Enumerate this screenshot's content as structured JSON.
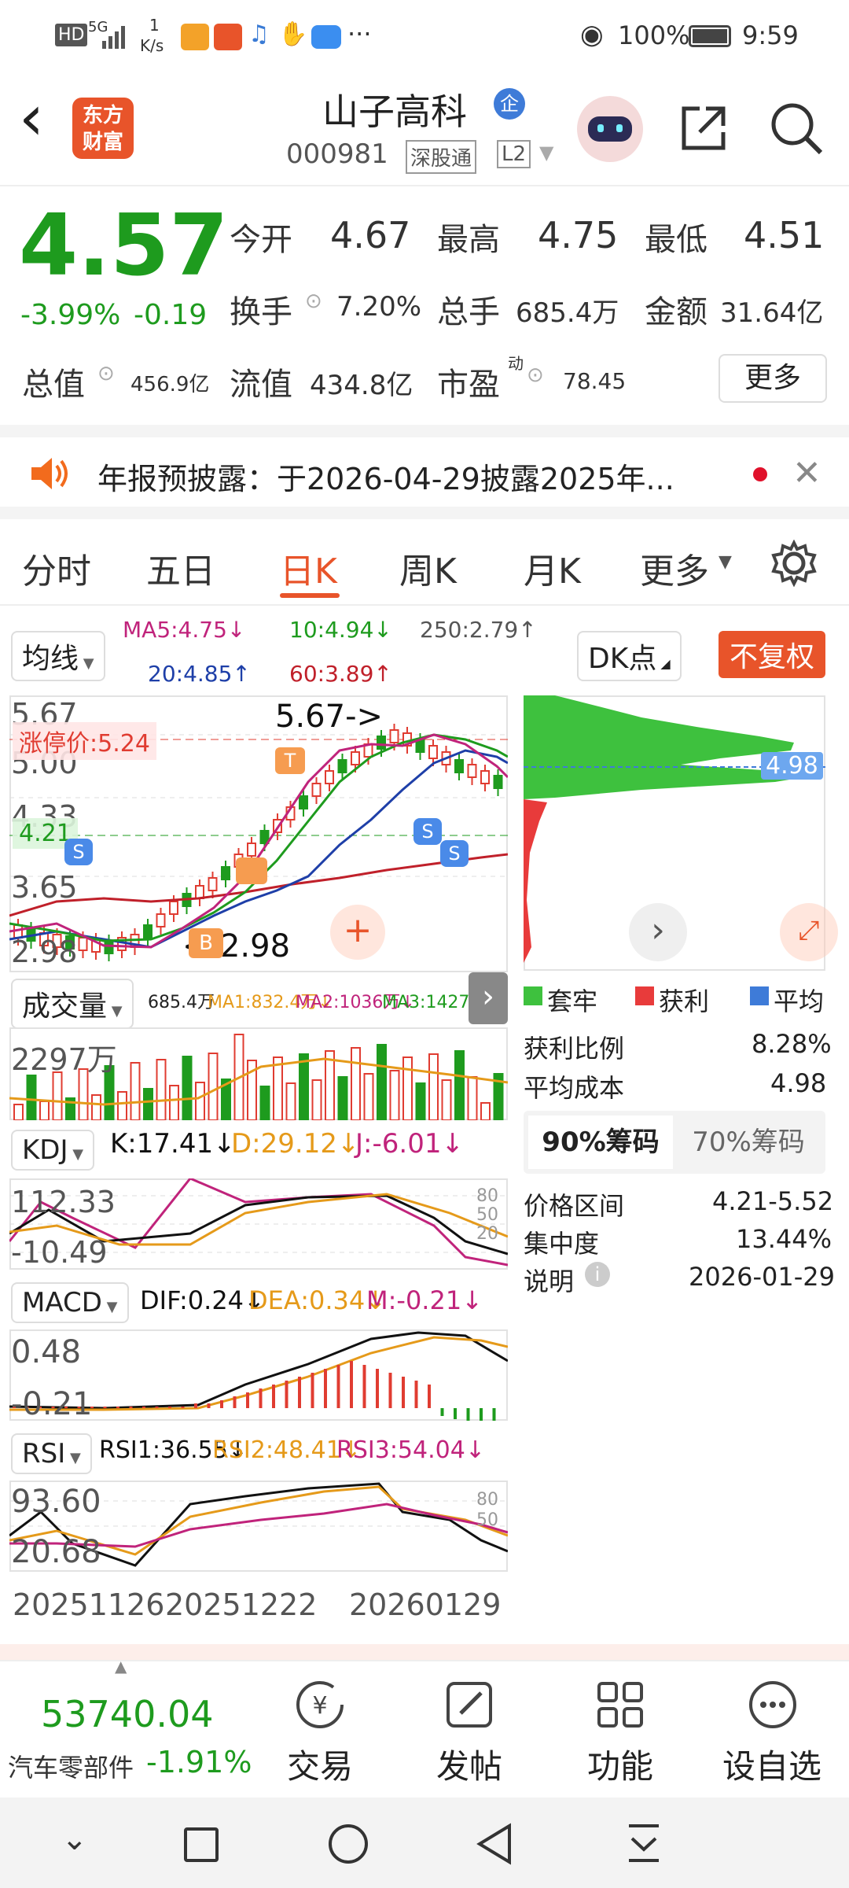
{
  "status": {
    "left_icons": [
      "HD",
      "5G"
    ],
    "speed_num": "1",
    "speed_unit": "K/s",
    "dots": "···",
    "battery": "100%",
    "time": "9:59"
  },
  "header": {
    "back": "‹",
    "brand_line1": "东方",
    "brand_line2": "财富",
    "stock_name": "山子高科",
    "badge": "企",
    "code": "000981",
    "tag1": "深股通",
    "tag2": "L2"
  },
  "quote": {
    "price": "4.57",
    "change_pct": "-3.99%",
    "change": "-0.19",
    "open_label": "今开",
    "open": "4.67",
    "high_label": "最高",
    "high": "4.75",
    "low_label": "最低",
    "low": "4.51",
    "turnover_label": "换手",
    "turnover": "7.20%",
    "volume_label": "总手",
    "volume": "685.4万",
    "amount_label": "金额",
    "amount": "31.64亿",
    "mcap_label": "总值",
    "mcap": "456.9亿",
    "float_label": "流值",
    "float": "434.8亿",
    "pe_label": "市盈",
    "pe_sup": "动",
    "pe": "78.45",
    "more": "更多"
  },
  "notice": {
    "text": "年报预披露：于2026-04-29披露2025年..."
  },
  "tabs": [
    "分时",
    "五日",
    "日K",
    "周K",
    "月K",
    "更多"
  ],
  "active_tab": 2,
  "ma": {
    "selector": "均线",
    "ma5": "MA5:4.75↓",
    "ma10": "10:4.94↓",
    "ma250": "250:2.79↑",
    "ma20": "20:4.85↑",
    "ma60": "60:3.89↑",
    "dk": "DK点",
    "fq": "不复权"
  },
  "kline": {
    "y_labels": [
      "5.67",
      "5.00",
      "4.33",
      "3.65",
      "2.98"
    ],
    "limit_up": "涨停价:5.24",
    "mark_high": "5.67->",
    "mark_low": "<-2.98",
    "price_tag": "4.98",
    "left_tag": "4.21"
  },
  "volume": {
    "selector": "成交量",
    "v": "685.4万",
    "ma1": "MA1:832.4万↓",
    "ma2": "MA2:1036万↓",
    "ma3": "MA3:1427万↓",
    "y": "2297万"
  },
  "kdj": {
    "selector": "KDJ",
    "k": "K:17.41↓",
    "d": "D:29.12↓",
    "j": "J:-6.01↓",
    "y1": "112.33",
    "y2": "-10.49",
    "r1": "80",
    "r2": "50",
    "r3": "20"
  },
  "macd": {
    "selector": "MACD",
    "dif": "DIF:0.24↓",
    "dea": "DEA:0.34↓",
    "m": "M:-0.21↓",
    "y1": "0.48",
    "y2": "-0.21"
  },
  "rsi": {
    "selector": "RSI",
    "r1": "RSI1:36.55↓",
    "r2": "RSI2:48.41↓",
    "r3": "RSI3:54.04↓",
    "y1": "93.60",
    "y2": "20.68",
    "t1": "80",
    "t2": "50"
  },
  "dates": [
    "20251126",
    "20251222",
    "20260129"
  ],
  "chips": {
    "legend": [
      "套牢",
      "获利",
      "平均"
    ],
    "profit_ratio_label": "获利比例",
    "profit_ratio": "8.28%",
    "avg_cost_label": "平均成本",
    "avg_cost": "4.98",
    "tab90": "90%筹码",
    "tab70": "70%筹码",
    "range_label": "价格区间",
    "range": "4.21-5.52",
    "conc_label": "集中度",
    "conc": "13.44%",
    "note_label": "说明",
    "note_date": "2026-01-29"
  },
  "bottom": {
    "index_value": "53740.04",
    "index_name": "汽车零部件",
    "index_change": "-1.91%",
    "items": [
      "交易",
      "发帖",
      "功能",
      "设自选"
    ]
  },
  "colors": {
    "accent": "#e8542a",
    "up": "#e03c31",
    "down": "#1e9b1e"
  }
}
